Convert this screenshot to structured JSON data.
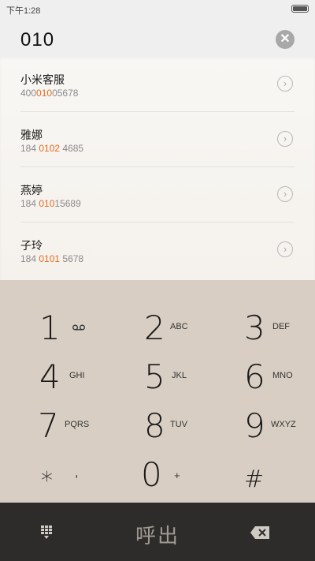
{
  "status": {
    "time": "下午1:28"
  },
  "dial": {
    "number": "010",
    "clear_icon": "clear-icon"
  },
  "contacts": [
    {
      "name": "小米客服",
      "num_pre": "400",
      "num_match": "010",
      "num_post": "05678"
    },
    {
      "name": "雅娜",
      "num_pre": "184 ",
      "num_match": "0102",
      "num_post": " 4685"
    },
    {
      "name": "燕婷",
      "num_pre": "184 ",
      "num_match": "010",
      "num_post": "15689"
    },
    {
      "name": "子玲",
      "num_pre": "184 ",
      "num_match": "0101",
      "num_post": " 5678"
    }
  ],
  "keypad": {
    "keys": [
      {
        "digit": "1",
        "letters": ""
      },
      {
        "digit": "2",
        "letters": "ABC"
      },
      {
        "digit": "3",
        "letters": "DEF"
      },
      {
        "digit": "4",
        "letters": "GHI"
      },
      {
        "digit": "5",
        "letters": "JKL"
      },
      {
        "digit": "6",
        "letters": "MNO"
      },
      {
        "digit": "7",
        "letters": "PQRS"
      },
      {
        "digit": "8",
        "letters": "TUV"
      },
      {
        "digit": "9",
        "letters": "WXYZ"
      },
      {
        "digit": "*",
        "letters": ","
      },
      {
        "digit": "0",
        "letters": "+"
      },
      {
        "digit": "#",
        "letters": ""
      }
    ]
  },
  "bottom": {
    "call_label": "呼出"
  },
  "colors": {
    "highlight": "#e86a1f",
    "keypad_bg": "#d9cec3",
    "bottom_bg": "#2e2c2a"
  }
}
